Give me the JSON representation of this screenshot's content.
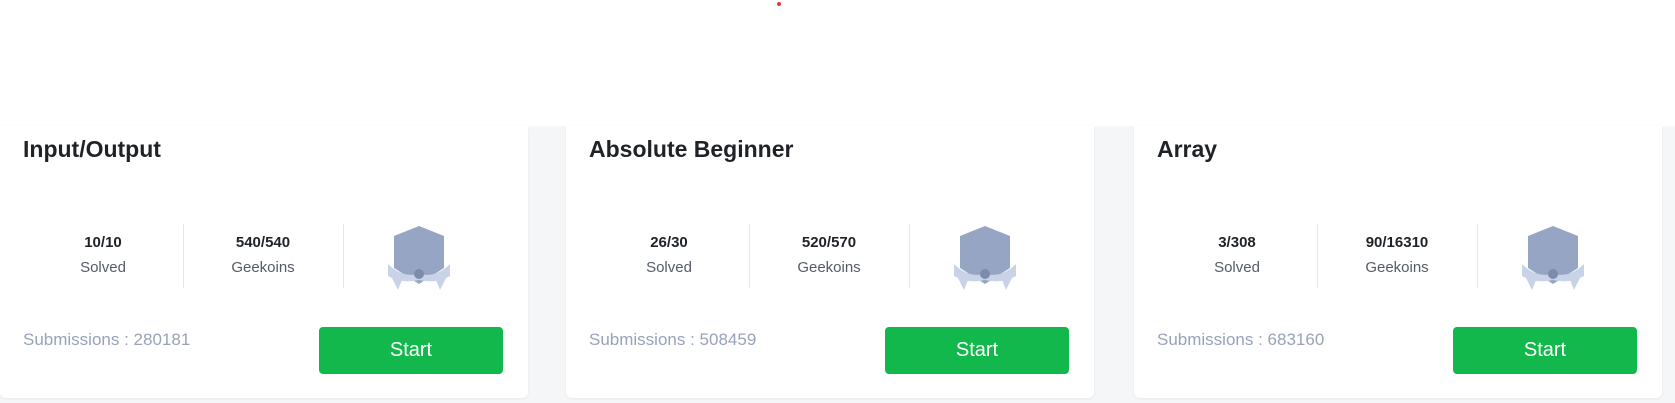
{
  "colors": {
    "button_bg": "#12b84b",
    "badge": "#96a5c3",
    "muted_text": "#98a2b8",
    "indicator_dot": "#e53935"
  },
  "cards": [
    {
      "title": "Input/Output",
      "solved_value": "10/10",
      "solved_label": "Solved",
      "geekoins_value": "540/540",
      "geekoins_label": "Geekoins",
      "badge_icon": "shield-badge-icon",
      "submissions": "Submissions : 280181",
      "button_label": "Start"
    },
    {
      "title": "Absolute Beginner",
      "solved_value": "26/30",
      "solved_label": "Solved",
      "geekoins_value": "520/570",
      "geekoins_label": "Geekoins",
      "badge_icon": "shield-badge-icon",
      "submissions": "Submissions : 508459",
      "button_label": "Start"
    },
    {
      "title": "Array",
      "solved_value": "3/308",
      "solved_label": "Solved",
      "geekoins_value": "90/16310",
      "geekoins_label": "Geekoins",
      "badge_icon": "shield-badge-icon",
      "submissions": "Submissions : 683160",
      "button_label": "Start"
    }
  ]
}
